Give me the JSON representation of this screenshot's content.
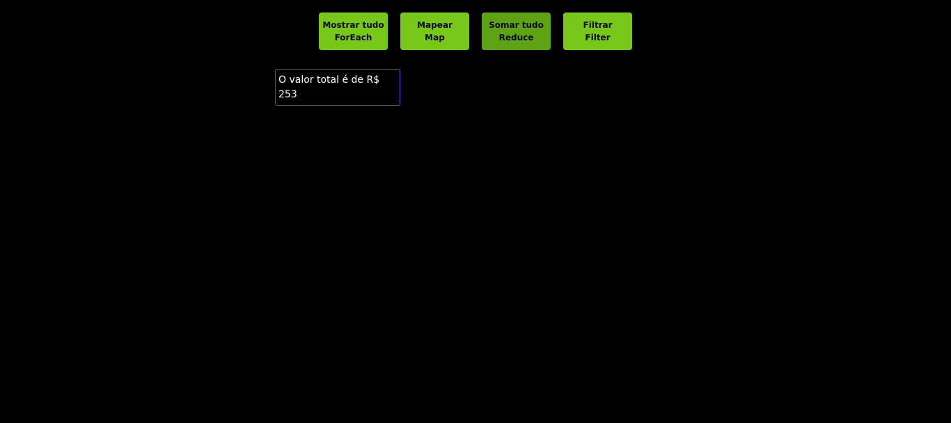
{
  "buttons": [
    {
      "line1": "Mostrar tudo",
      "line2": "ForEach",
      "color": "#78c81a"
    },
    {
      "line1": "Mapear",
      "line2": "Map",
      "color": "#78c81a"
    },
    {
      "line1": "Somar tudo",
      "line2": "Reduce",
      "color": "#5da314"
    },
    {
      "line1": "Filtrar",
      "line2": "Filter",
      "color": "#78c81a"
    }
  ],
  "result": {
    "text": "O valor total é de R$ 253",
    "border_color": "#6a35e6"
  },
  "theme": {
    "background": "#000000",
    "button_text": "#0a0a0a",
    "result_text": "#ffffff"
  }
}
